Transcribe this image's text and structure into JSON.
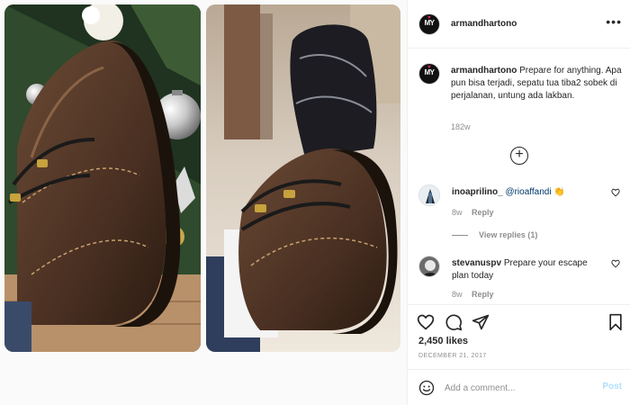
{
  "post": {
    "username": "armandhartono",
    "caption": "Prepare for anything. Apa pun bisa terjadi, sepatu tua tiba2 sobek di perjalanan, untung ada lakban.",
    "caption_age": "182w",
    "avatar_text": "MY"
  },
  "comments": [
    {
      "username": "inoaprilino_",
      "mention": "@rioaffandi",
      "emoji": "👏",
      "age": "8w",
      "reply_label": "Reply",
      "view_replies": "View replies (1)"
    },
    {
      "username": "stevanuspv",
      "text": "Prepare your escape plan today",
      "age": "8w",
      "reply_label": "Reply"
    }
  ],
  "stats": {
    "likes": "2,450 likes",
    "date": "DECEMBER 21, 2017"
  },
  "composer": {
    "placeholder": "Add a comment...",
    "post_label": "Post"
  },
  "icons": {
    "more": "more-options-icon",
    "load_more": "plus-circle-icon",
    "like": "heart-icon",
    "comment": "comment-icon",
    "share": "paper-plane-icon",
    "save": "bookmark-icon",
    "emoji": "smiley-icon"
  },
  "colors": {
    "text": "#262626",
    "muted": "#8e8e8e",
    "link": "#00376b",
    "post_button": "#b2dffc"
  }
}
